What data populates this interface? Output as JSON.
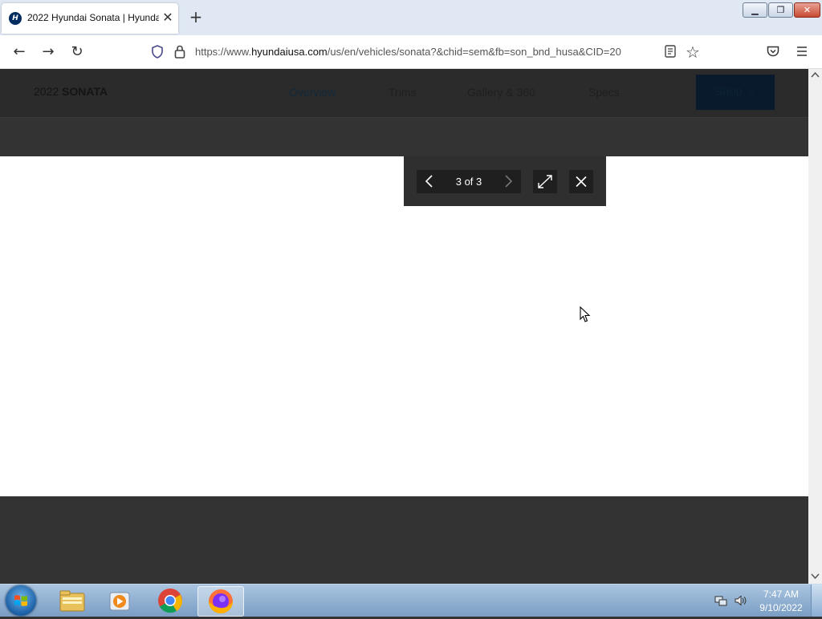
{
  "browser": {
    "tab_title": "2022 Hyundai Sonata | Hyundai",
    "favicon": "hyundai-logo-icon",
    "url_prefix": "https://www.",
    "url_domain": "hyundaiusa.com",
    "url_path": "/us/en/vehicles/sonata?&chid=sem&fb=son_bnd_husa&CID=20"
  },
  "site": {
    "model_year": "2022",
    "model_name": "SONATA",
    "nav": [
      "Overview",
      "Trims",
      "Gallery & 360",
      "Specs"
    ],
    "shop_label": "Shop"
  },
  "gallery": {
    "pager_text": "3 of 3"
  },
  "taskbar": {
    "time": "7:47 AM",
    "date": "9/10/2022",
    "apps": [
      "windows-explorer-icon",
      "media-player-icon",
      "chrome-icon",
      "firefox-icon"
    ]
  },
  "colors": {
    "overlay": "#333333",
    "brand_dark": "#081a2b",
    "taskbar": "#8fb1d6"
  }
}
